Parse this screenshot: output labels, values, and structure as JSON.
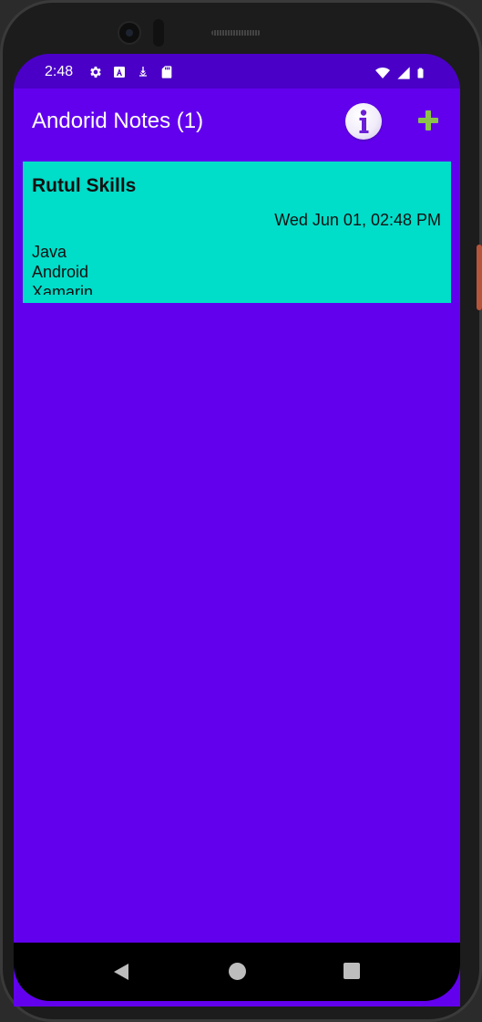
{
  "status_bar": {
    "time": "2:48",
    "left_icons": [
      "settings-icon",
      "text-a-icon",
      "download-icon",
      "sd-card-icon"
    ],
    "right_icons": [
      "wifi-icon",
      "signal-icon",
      "battery-icon"
    ]
  },
  "app_bar": {
    "title": "Andorid Notes (1)",
    "info_icon": "info-icon",
    "add_icon": "add-icon",
    "background": "#6200EE",
    "add_color": "#8BC34A"
  },
  "notes": [
    {
      "title": "Rutul Skills",
      "date": "Wed Jun 01, 02:48 PM",
      "body_lines": [
        "Java",
        "Android",
        "Xamarin"
      ],
      "background": "#00DDC9"
    }
  ],
  "nav_bar": {
    "icons": [
      "back-icon",
      "home-icon",
      "recents-icon"
    ]
  }
}
